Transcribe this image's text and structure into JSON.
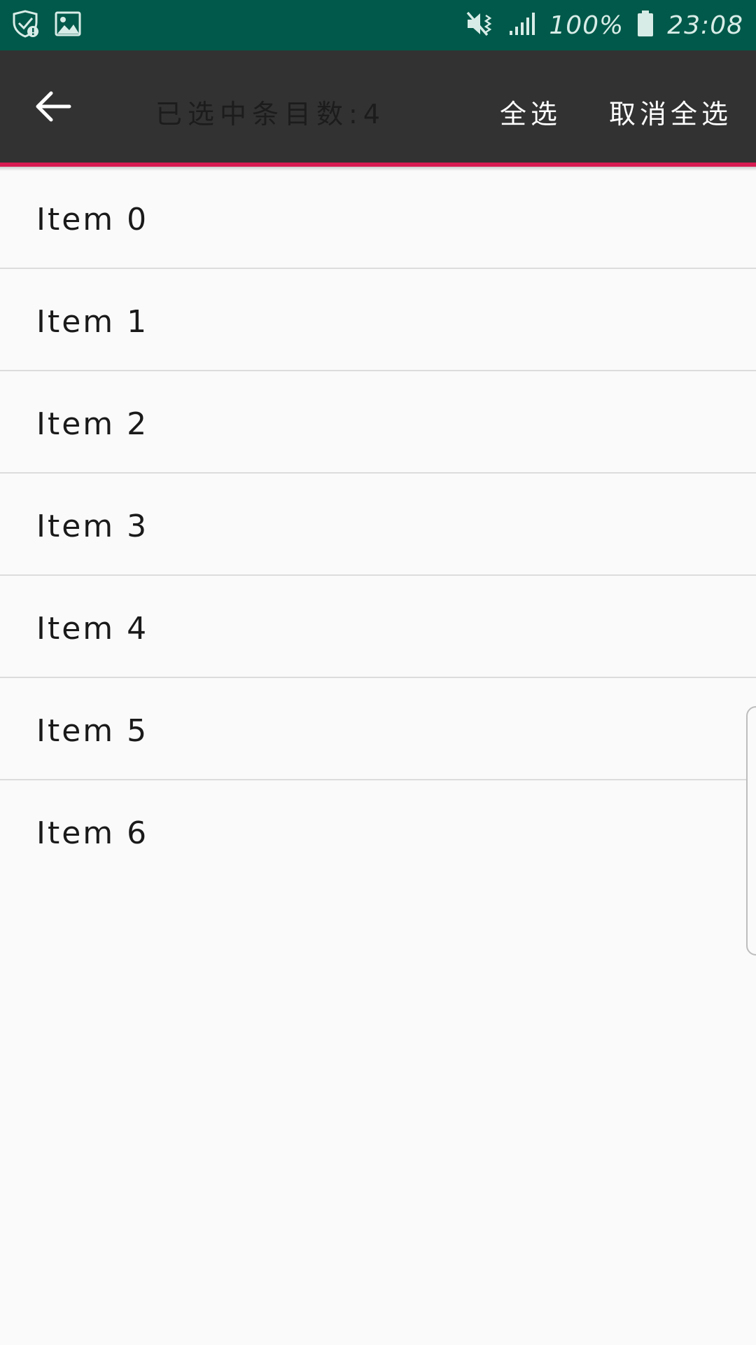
{
  "status_bar": {
    "battery_percent": "100%",
    "time": "23:08",
    "icons": [
      "shield-warning-icon",
      "gallery-icon",
      "mute-icon",
      "signal-icon",
      "battery-icon"
    ],
    "background_color": "#00594a"
  },
  "toolbar": {
    "title": "已选中条目数:4",
    "select_all_label": "全选",
    "deselect_all_label": "取消全选",
    "back_icon": "arrow-left-icon",
    "background_color": "#323232",
    "accent_color": "#d81b52"
  },
  "list": {
    "items": [
      {
        "label": "Item 0"
      },
      {
        "label": "Item 1"
      },
      {
        "label": "Item 2"
      },
      {
        "label": "Item 3"
      },
      {
        "label": "Item 4"
      },
      {
        "label": "Item 5"
      },
      {
        "label": "Item 6"
      }
    ]
  }
}
